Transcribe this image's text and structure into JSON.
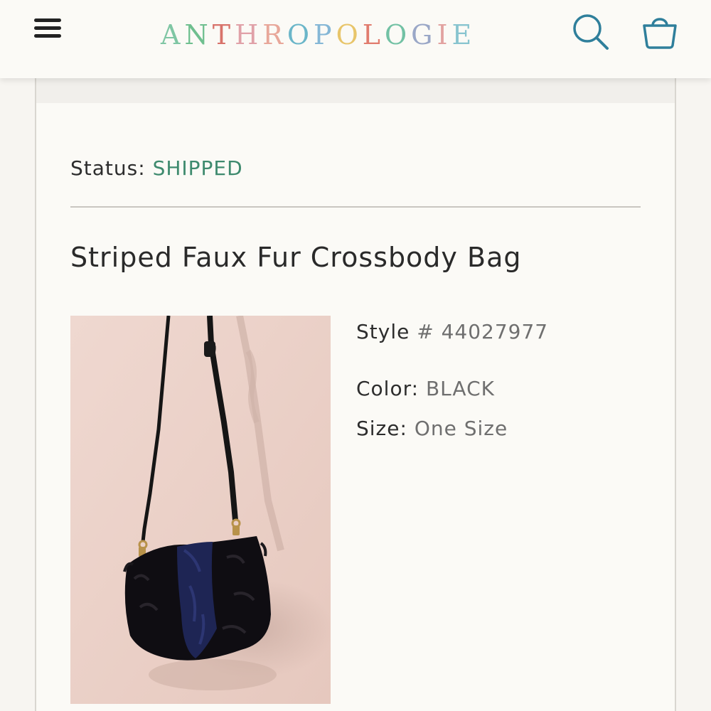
{
  "header": {
    "logo_letters": [
      {
        "ch": "A",
        "color": "#7fc6a4"
      },
      {
        "ch": "N",
        "color": "#6fbf8f"
      },
      {
        "ch": "T",
        "color": "#d8736b"
      },
      {
        "ch": "H",
        "color": "#e0a1a8"
      },
      {
        "ch": "R",
        "color": "#e8a79a"
      },
      {
        "ch": "O",
        "color": "#6bb6c9"
      },
      {
        "ch": "P",
        "color": "#85b7d6"
      },
      {
        "ch": "O",
        "color": "#e8c56a"
      },
      {
        "ch": "L",
        "color": "#e17c6e"
      },
      {
        "ch": "O",
        "color": "#72c1a4"
      },
      {
        "ch": "G",
        "color": "#9aa7c7"
      },
      {
        "ch": "I",
        "color": "#e2a2a0"
      },
      {
        "ch": "E",
        "color": "#88c4cf"
      }
    ],
    "menu_icon": "hamburger-menu-icon",
    "search_icon": "search-icon",
    "bag_icon": "shopping-bag-icon",
    "accent_color": "#2f7f9b"
  },
  "order": {
    "status_label": "Status:",
    "status_value": "SHIPPED",
    "status_color": "#3e8a6e"
  },
  "product": {
    "title": "Striped Faux Fur Crossbody Bag",
    "style_label": "Style",
    "style_value": "# 44027977",
    "color_label": "Color:",
    "color_value": "BLACK",
    "size_label": "Size:",
    "size_value": "One Size"
  }
}
